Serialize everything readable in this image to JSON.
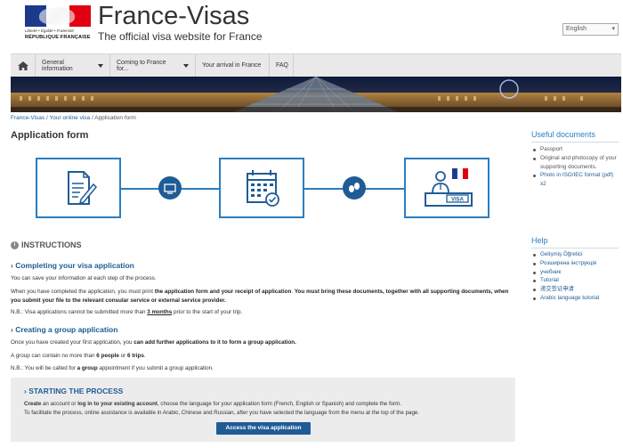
{
  "header": {
    "logo_motto": "Liberté • Égalité • Fraternité",
    "logo_republic": "RÉPUBLIQUE FRANÇAISE",
    "site_title": "France-Visas",
    "site_subtitle": "The official visa website for France",
    "language": "English"
  },
  "nav": {
    "items": [
      {
        "label": "General information",
        "dropdown": true
      },
      {
        "label": "Coming to France for...",
        "dropdown": true
      },
      {
        "label": "Your arrival in France",
        "dropdown": false
      },
      {
        "label": "FAQ",
        "dropdown": false
      }
    ]
  },
  "breadcrumb": {
    "items": [
      "France-Visas",
      "Your online visa",
      "Application form"
    ],
    "separator": "/"
  },
  "page_title": "Application form",
  "process": {
    "steps": [
      "document-edit-icon",
      "calendar-check-icon",
      "visa-office-icon"
    ],
    "connectors": [
      "computer-icon",
      "footsteps-icon"
    ],
    "visa_label": "VISA"
  },
  "instructions": {
    "title": "INSTRUCTIONS",
    "s1_title": "Completing your visa application",
    "s1_p1": "You can save your information at each step of the process.",
    "s1_p2_a": "When you have completed the application, you must print ",
    "s1_p2_b": "the application form and your receipt of application",
    "s1_p2_c": ".  ",
    "s1_p2_d": "You must bring these documents, together with all supporting documents, when you submit your file to the relevant consular service or external service provider.",
    "s1_nb_a": "N.B.: ",
    "s1_nb_b": "Visa applications cannot be submitted more than ",
    "s1_nb_c": "3 months",
    "s1_nb_d": " prior to the start of your trip.",
    "s2_title": "Creating a group application",
    "s2_p1_a": "Once you have created your first application, you ",
    "s2_p1_b": "can add further applications to it to form a group application.",
    "s2_p2_a": "A group can contain no more than ",
    "s2_p2_b": "6 people",
    "s2_p2_c": " or ",
    "s2_p2_d": "6 trips",
    "s2_p2_e": ".",
    "s2_nb_a": "N.B.: ",
    "s2_nb_b": "You will be called for ",
    "s2_nb_c": "a group",
    "s2_nb_d": " appointment if you submit a group application."
  },
  "start": {
    "title": "STARTING THE PROCESS",
    "p1_a": "Create",
    "p1_b": " an account or ",
    "p1_c": "log in to your existing account",
    "p1_d": ", choose the language for your application form (French, English or Spanish) and complete the form.",
    "p2": "To facilitate the process, online assistance is available in Arabic, Chinese and Russian, after you have selected the language from the menu at the top of the page.",
    "button": "Access the visa application"
  },
  "sidebar": {
    "docs_title": "Useful documents",
    "docs": [
      "Passport",
      "Original and photocopy of your supporting documents.",
      "Photo in ISO/IEC format (pdf) x2"
    ],
    "help_title": "Help",
    "help": [
      "Gelişmiş Öğretici",
      "Розширена інструкція",
      "учебник",
      "Tutorial",
      "递交签证申请",
      "Arabic language tutorial"
    ]
  }
}
